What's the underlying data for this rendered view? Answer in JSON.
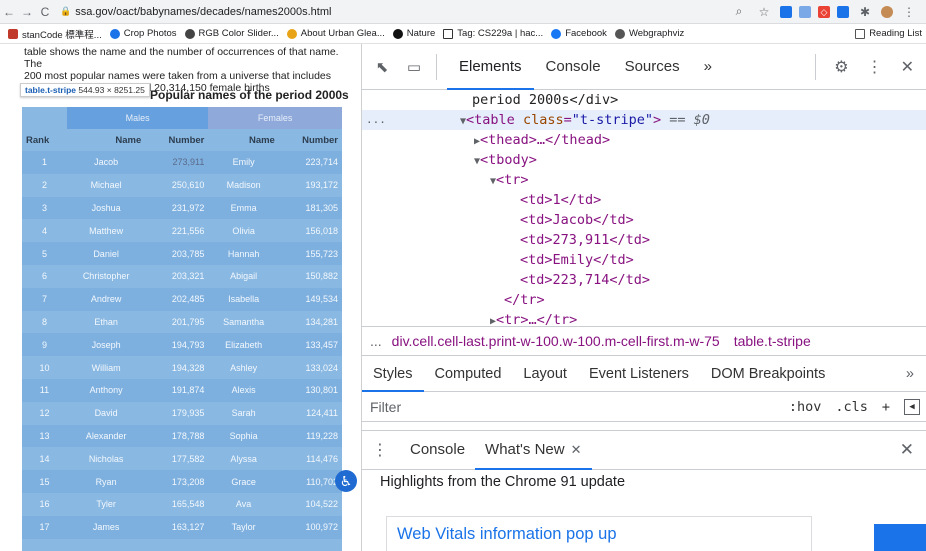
{
  "browser": {
    "url": "ssa.gov/oact/babynames/decades/names2000s.html",
    "bookmarks": [
      "stanCode 標準程...",
      "Crop Photos",
      "RGB Color Slider...",
      "About Urban Glea...",
      "Nature",
      "Tag: CS229a | hac...",
      "Facebook",
      "Webgraphviz"
    ],
    "reading_list": "Reading List"
  },
  "page": {
    "intro_line1": "table shows the name and the number of occurrences of that name. The",
    "intro_line2": "200 most popular names were taken from a universe that includes",
    "intro_line3": "21,367,624 male births and 20,314,150 female births",
    "caption": "Popular names of the period 2000s",
    "tooltip_selector": "table.t-stripe",
    "tooltip_size": "544.93 × 8251.25",
    "group_males": "Males",
    "group_females": "Females",
    "columns": [
      "Rank",
      "Name",
      "Number",
      "Name",
      "Number"
    ],
    "rows": [
      [
        "1",
        "Jacob",
        "273,911",
        "Emily",
        "223,714"
      ],
      [
        "2",
        "Michael",
        "250,610",
        "Madison",
        "193,172"
      ],
      [
        "3",
        "Joshua",
        "231,972",
        "Emma",
        "181,305"
      ],
      [
        "4",
        "Matthew",
        "221,556",
        "Olivia",
        "156,018"
      ],
      [
        "5",
        "Daniel",
        "203,785",
        "Hannah",
        "155,723"
      ],
      [
        "6",
        "Christopher",
        "203,321",
        "Abigail",
        "150,882"
      ],
      [
        "7",
        "Andrew",
        "202,485",
        "Isabella",
        "149,534"
      ],
      [
        "8",
        "Ethan",
        "201,795",
        "Samantha",
        "134,281"
      ],
      [
        "9",
        "Joseph",
        "194,793",
        "Elizabeth",
        "133,457"
      ],
      [
        "10",
        "William",
        "194,328",
        "Ashley",
        "133,024"
      ],
      [
        "11",
        "Anthony",
        "191,874",
        "Alexis",
        "130,801"
      ],
      [
        "12",
        "David",
        "179,935",
        "Sarah",
        "124,411"
      ],
      [
        "13",
        "Alexander",
        "178,788",
        "Sophia",
        "119,228"
      ],
      [
        "14",
        "Nicholas",
        "177,582",
        "Alyssa",
        "114,476"
      ],
      [
        "15",
        "Ryan",
        "173,208",
        "Grace",
        "110,702"
      ],
      [
        "16",
        "Tyler",
        "165,548",
        "Ava",
        "104,522"
      ],
      [
        "17",
        "James",
        "163,127",
        "Taylor",
        "100,972"
      ]
    ]
  },
  "devtools": {
    "tabs": [
      "Elements",
      "Console",
      "Sources"
    ],
    "more": "»",
    "dom": {
      "line0": "period 2000s</div>",
      "table_open_tag": "table",
      "table_class_attr": "class",
      "table_class_val": "\"t-stripe\"",
      "table_eq": "== $0",
      "thead": "<thead>…</thead>",
      "tbody": "<tbody>",
      "tr_open": "<tr>",
      "tds": [
        "<td>1</td>",
        "<td>Jacob</td>",
        "<td>273,911</td>",
        "<td>Emily</td>",
        "<td>223,714</td>"
      ],
      "tr_close": "</tr>",
      "tr_collapsed": "<tr>…</tr>"
    },
    "breadcrumb": [
      "div.cell.cell-last.print-w-100.w-100.m-cell-first.m-w-75",
      "table.t-stripe"
    ],
    "breadcrumb_dots": "...",
    "subtabs": [
      "Styles",
      "Computed",
      "Layout",
      "Event Listeners",
      "DOM Breakpoints"
    ],
    "filter_placeholder": "Filter",
    "filter_hov": ":hov",
    "filter_cls": ".cls",
    "filter_plus": "+",
    "drawer_tabs": [
      "Console",
      "What's New"
    ],
    "news_heading": "Highlights from the Chrome 91 update",
    "news_card_title": "Web Vitals information pop up"
  }
}
